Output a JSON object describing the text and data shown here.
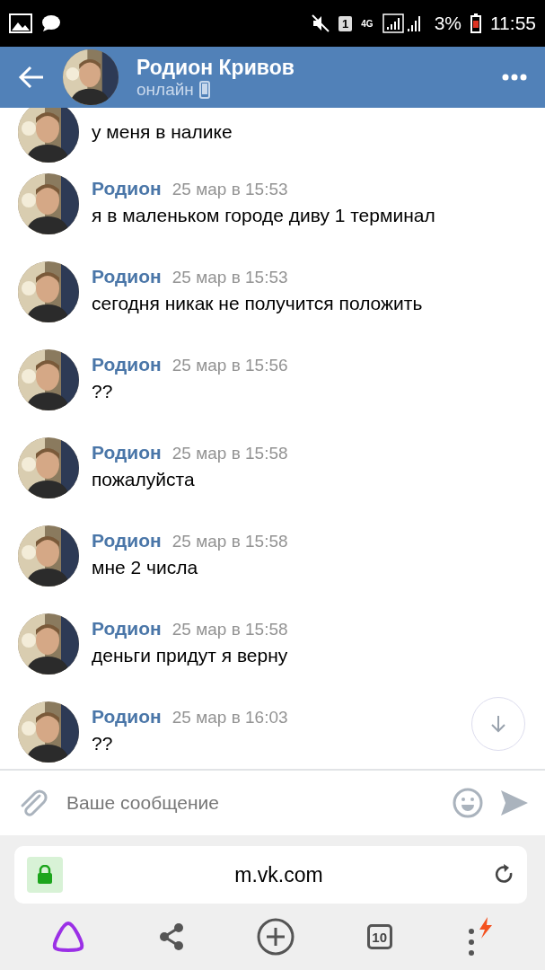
{
  "status_bar": {
    "sim": "1",
    "network": "4G",
    "battery": "3%",
    "time": "11:55"
  },
  "header": {
    "name": "Родион Кривов",
    "status": "онлайн"
  },
  "messages": [
    {
      "text": "у меня в налике"
    },
    {
      "author": "Родион",
      "time": "25 мар в 15:53",
      "text": "я в маленьком городе диву 1 терминал"
    },
    {
      "author": "Родион",
      "time": "25 мар в 15:53",
      "text": "сегодня никак не получится положить"
    },
    {
      "author": "Родион",
      "time": "25 мар в 15:56",
      "text": "??"
    },
    {
      "author": "Родион",
      "time": "25 мар в 15:58",
      "text": "пожалуйста"
    },
    {
      "author": "Родион",
      "time": "25 мар в 15:58",
      "text": "мне 2 числа"
    },
    {
      "author": "Родион",
      "time": "25 мар в 15:58",
      "text": "деньги придут я верну"
    },
    {
      "author": "Родион",
      "time": "25 мар в 16:03",
      "text": "??"
    }
  ],
  "composer": {
    "placeholder": "Ваше сообщение"
  },
  "browser": {
    "url": "m.vk.com",
    "tabs_count": "10"
  }
}
